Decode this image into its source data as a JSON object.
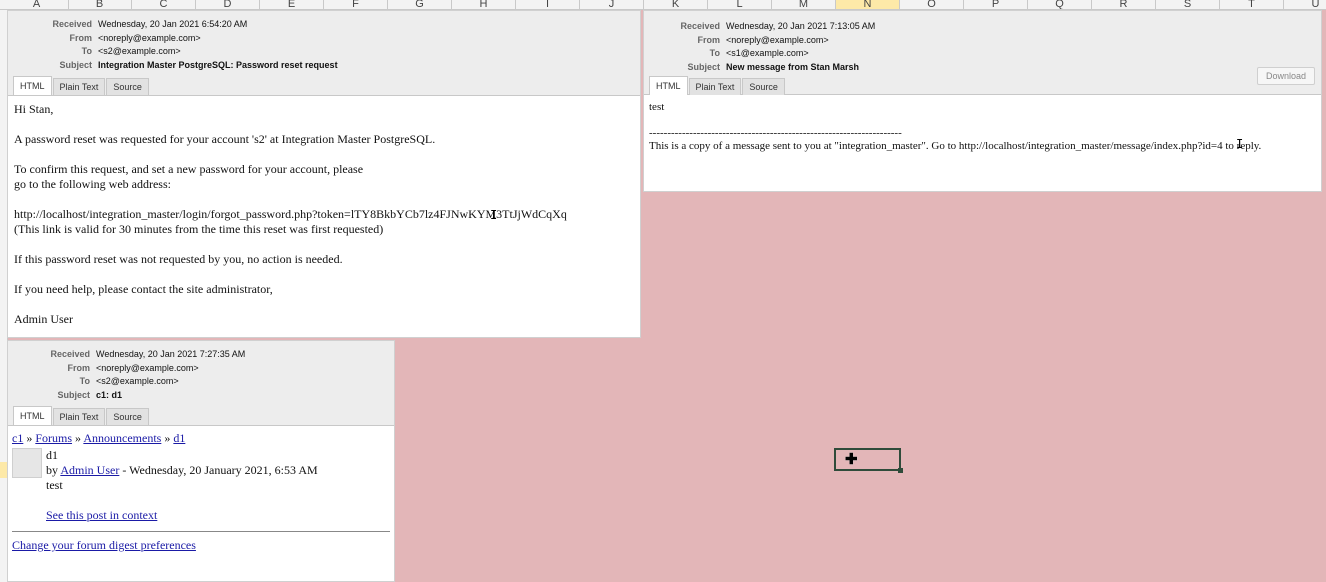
{
  "spreadsheet": {
    "columns": [
      "A",
      "B",
      "C",
      "D",
      "E",
      "F",
      "G",
      "H",
      "I",
      "J",
      "K",
      "L",
      "M",
      "N",
      "O",
      "P",
      "Q",
      "R",
      "S",
      "T",
      "U"
    ],
    "selected_column": "N"
  },
  "message1": {
    "received_label": "Received",
    "received": "Wednesday, 20 Jan 2021 6:54:20 AM",
    "from_label": "From",
    "from": "<noreply@example.com>",
    "to_label": "To",
    "to": "<s2@example.com>",
    "subject_label": "Subject",
    "subject": "Integration Master PostgreSQL: Password reset request",
    "tabs": [
      "HTML",
      "Plain Text",
      "Source"
    ],
    "body": {
      "greeting": "Hi Stan,",
      "line1": "A password reset was requested for your account 's2' at Integration Master PostgreSQL.",
      "line2a": "To confirm this request, and set a new password for your account, please",
      "line2b": "go to the following web address:",
      "link": "http://localhost/integration_master/login/forgot_password.php?token=lTY8BkbYCb7lz4FJNwKYM3TtJjWdCqXq",
      "validity": "(This link is valid for 30 minutes from the time this reset was first requested)",
      "line3": "If this password reset was not requested by you, no action is needed.",
      "line4": "If you need help, please contact the site administrator,",
      "signature": "Admin User"
    }
  },
  "message2": {
    "received_label": "Received",
    "received": "Wednesday, 20 Jan 2021 7:13:05 AM",
    "from_label": "From",
    "from": "<noreply@example.com>",
    "to_label": "To",
    "to": "<s1@example.com>",
    "subject_label": "Subject",
    "subject": "New message from Stan Marsh",
    "download_label": "Download",
    "tabs": [
      "HTML",
      "Plain Text",
      "Source"
    ],
    "body": {
      "text": "test",
      "divider": "---------------------------------------------------------------------",
      "footer": "This is a copy of a message sent to you at \"integration_master\". Go to http://localhost/integration_master/message/index.php?id=4 to reply."
    }
  },
  "message3": {
    "received_label": "Received",
    "received": "Wednesday, 20 Jan 2021 7:27:35 AM",
    "from_label": "From",
    "from": "<noreply@example.com>",
    "to_label": "To",
    "to": "<s2@example.com>",
    "subject_label": "Subject",
    "subject": "c1: d1",
    "tabs": [
      "HTML",
      "Plain Text",
      "Source"
    ],
    "body": {
      "breadcrumb": [
        "c1",
        "Forums",
        "Announcements",
        "d1"
      ],
      "separator": "»",
      "post_title": "d1",
      "by_prefix": "by",
      "author": "Admin User",
      "date_suffix": "- Wednesday, 20 January 2021, 6:53 AM",
      "text": "test",
      "context_link": "See this post in context",
      "digest_link": "Change your forum digest preferences"
    }
  }
}
